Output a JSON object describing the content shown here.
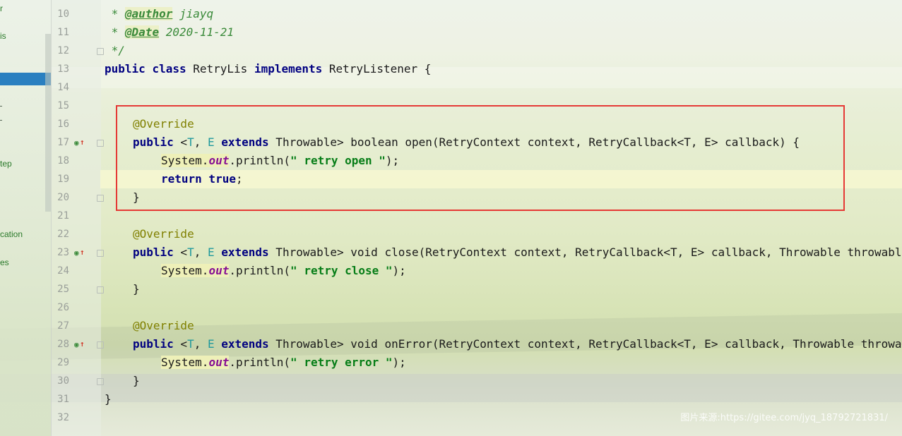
{
  "project_panel": {
    "items": [
      "r",
      "is",
      "-",
      "r",
      "tep",
      "cation",
      "es"
    ]
  },
  "editor": {
    "line_numbers": [
      "10",
      "11",
      "12",
      "13",
      "14",
      "15",
      "16",
      "17",
      "18",
      "19",
      "20",
      "21",
      "22",
      "23",
      "24",
      "25",
      "26",
      "27",
      "28",
      "29",
      "30",
      "31",
      "32"
    ],
    "javadoc": {
      "line10": {
        "prefix": " * ",
        "tag": "@author",
        "value": " jiayq"
      },
      "line11": {
        "prefix": " * ",
        "tag": "@Date",
        "value": " 2020-11-21"
      },
      "line12": " */"
    },
    "class_decl": {
      "public": "public",
      "class": "class",
      "name": " RetryLis ",
      "implements": "implements",
      "iface": " RetryListener {"
    },
    "annotation": "@Override",
    "methods": [
      {
        "sig_rest": " boolean open(RetryContext context, RetryCallback<T, E> callback) {",
        "print_arg": "\" retry open \"",
        "has_return": true
      },
      {
        "sig_rest": " void close(RetryContext context, RetryCallback<T, E> callback, Throwable throwable) {",
        "print_arg": "\" retry close \"",
        "has_return": false
      },
      {
        "sig_rest": " void onError(RetryContext context, RetryCallback<T, E> callback, Throwable throwable) {",
        "print_arg": "\" retry error \"",
        "has_return": false
      }
    ],
    "tokens": {
      "public": "public",
      "generic_open": " <",
      "T": "T",
      "comma": ", ",
      "E": "E",
      "extends": " extends",
      "throwable": " Throwable>",
      "system": "System.",
      "out": "out",
      "println": ".println(",
      "close_call": ");",
      "return": "return",
      "true": " true",
      "semi": ";",
      "brace_close": "}",
      "class_close": "}"
    }
  },
  "watermark": "图片来源:https://gitee.com/jyq_18792721831/",
  "colors": {
    "keyword": "#000080",
    "comment": "#3a8a3a",
    "annotation": "#808000",
    "string": "#067d17",
    "highlight_box": "#e53935",
    "selection": "#2a7fc0"
  }
}
